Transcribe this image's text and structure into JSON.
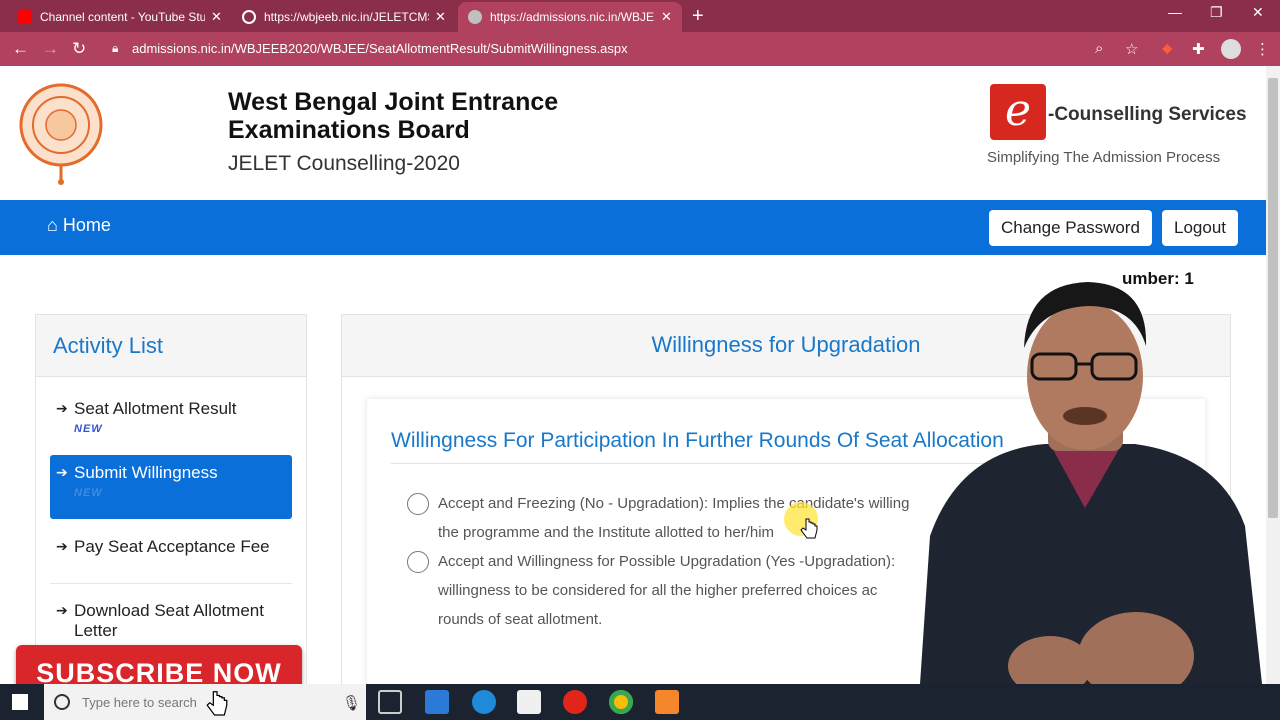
{
  "browser": {
    "tabs": [
      {
        "title": "Channel content - YouTube Studio",
        "icon": "youtube-icon",
        "color": "#ff0000"
      },
      {
        "title": "https://wbjeeb.nic.in/JELETCMS/p",
        "icon": "globe-icon",
        "color": "#ffffff"
      },
      {
        "title": "https://admissions.nic.in/WBJEEB",
        "icon": "nic-icon",
        "color": "#c0c0c0"
      }
    ],
    "url": "admissions.nic.in/WBJEEB2020/WBJEE/SeatAllotmentResult/SubmitWillingness.aspx"
  },
  "header": {
    "org_line1": "West Bengal Joint Entrance",
    "org_line2": "Examinations Board",
    "subtitle": "JELET Counselling-2020",
    "ec_letter": "e",
    "ec_title": "-Counselling Services",
    "ec_tagline": "Simplifying The Admission Process"
  },
  "nav": {
    "home": "Home",
    "change_password": "Change Password",
    "logout": "Logout"
  },
  "registration_fragment": "umber: 1",
  "sidebar": {
    "title": "Activity List",
    "items": [
      {
        "label": "Seat Allotment Result",
        "badge": "NEW"
      },
      {
        "label": "Submit Willingness",
        "badge": "NEW"
      },
      {
        "label": "Pay Seat Acceptance Fee",
        "badge": ""
      },
      {
        "label": "Download Seat Allotment Letter",
        "badge": ""
      }
    ]
  },
  "main": {
    "panel_title": "Willingness for Upgradation",
    "card_title": "Willingness For Participation In Further Rounds Of Seat Allocation",
    "option1_line1": "Accept and Freezing (No - Upgradation): Implies the candidate's willing",
    "option1_line2": "the programme and the Institute allotted to her/him",
    "option2_line1": "Accept and Willingness for Possible Upgradation (Yes -Upgradation):",
    "option2_line2": "willingness to be considered for all the higher preferred choices ac",
    "option2_line3": "rounds of seat allotment."
  },
  "overlay": {
    "subscribe": "SUBSCRIBE NOW"
  },
  "taskbar": {
    "search_placeholder": "Type here to search"
  },
  "colors": {
    "tabbar": "#8a2e49",
    "addressbar": "#b0415f",
    "navbar": "#0a6fd9",
    "heading_blue": "#1a78c9",
    "subscribe_red": "#d9262b"
  }
}
